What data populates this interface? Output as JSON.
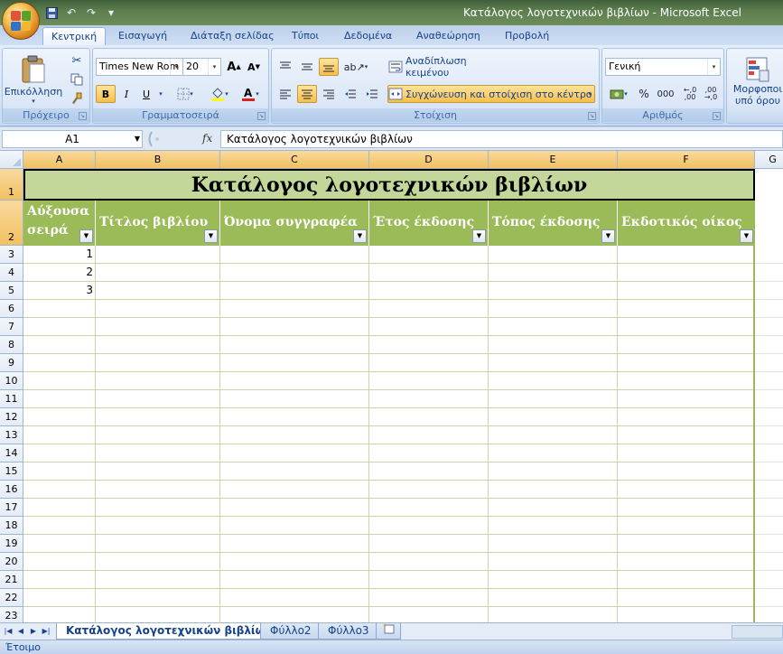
{
  "window": {
    "title": "Κατάλογος λογοτεχνικών βιβλίων - Microsoft Excel"
  },
  "ribbon": {
    "tabs": [
      "Κεντρική",
      "Εισαγωγή",
      "Διάταξη σελίδας",
      "Τύποι",
      "Δεδομένα",
      "Αναθεώρηση",
      "Προβολή"
    ],
    "active_tab": "Κεντρική",
    "clipboard": {
      "label": "Πρόχειρο",
      "paste": "Επικόλληση"
    },
    "font": {
      "label": "Γραμματοσειρά",
      "name": "Times New Rom",
      "size": "20",
      "bold": "B",
      "italic": "I",
      "underline": "U"
    },
    "alignment": {
      "label": "Στοίχιση",
      "wrap_text": "Αναδίπλωση κειμένου",
      "merge_center": "Συγχώνευση και στοίχιση στο κέντρο"
    },
    "number": {
      "label": "Αριθμός",
      "format": "Γενική",
      "percent": "%",
      "thousands": "000",
      "inc_decimal": "←,0 ,00",
      "dec_decimal": ",00 →,0"
    },
    "styles": {
      "conditional_format_line1": "Μορφοποι",
      "conditional_format_line2": "υπό όρου"
    }
  },
  "formula_bar": {
    "name_box": "A1",
    "fx": "fx",
    "content": "Κατάλογος λογοτεχνικών βιβλίων"
  },
  "columns": [
    "A",
    "B",
    "C",
    "D",
    "E",
    "F",
    "G"
  ],
  "rows": [
    "1",
    "2",
    "3",
    "4",
    "5",
    "6",
    "7",
    "8",
    "9",
    "10",
    "11",
    "12",
    "13",
    "14",
    "15",
    "16",
    "17",
    "18",
    "19",
    "20",
    "21",
    "22",
    "23"
  ],
  "sheet": {
    "title": "Κατάλογος λογοτεχνικών βιβλίων",
    "headers": [
      "Αύξουσα σειρά",
      "Τίτλος βιβλίου",
      "Όνομα συγγραφέα",
      "Έτος έκδοσης",
      "Τόπος έκδοσης",
      "Εκδοτικός οίκος"
    ],
    "serial_numbers": [
      "1",
      "2",
      "3"
    ]
  },
  "sheet_tabs": [
    "Κατάλογος λογοτεχνικών βιβλίων",
    "Φύλλο2",
    "Φύλλο3"
  ],
  "status": "Έτοιμο",
  "colors": {
    "title_fill": "#c4d79b",
    "header_fill": "#9bbb59",
    "selected_header": "#f1c15f"
  }
}
